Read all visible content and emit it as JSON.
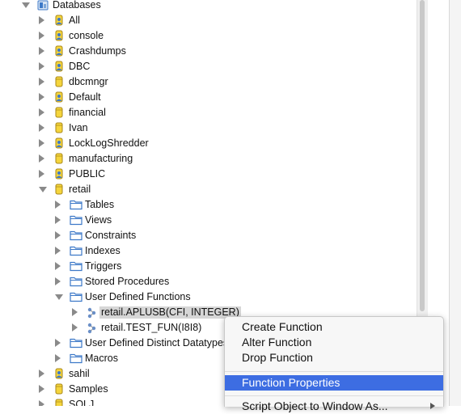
{
  "tree": {
    "root": {
      "label": "Databases",
      "icon": "database-server-icon"
    },
    "databases": [
      {
        "label": "All",
        "icon": "database-user-icon"
      },
      {
        "label": "console",
        "icon": "database-user-icon"
      },
      {
        "label": "Crashdumps",
        "icon": "database-user-icon"
      },
      {
        "label": "DBC",
        "icon": "database-user-icon"
      },
      {
        "label": "dbcmngr",
        "icon": "database-icon"
      },
      {
        "label": "Default",
        "icon": "database-user-icon"
      },
      {
        "label": "financial",
        "icon": "database-icon"
      },
      {
        "label": "Ivan",
        "icon": "database-icon"
      },
      {
        "label": "LockLogShredder",
        "icon": "database-user-icon"
      },
      {
        "label": "manufacturing",
        "icon": "database-icon"
      },
      {
        "label": "PUBLIC",
        "icon": "database-user-icon"
      },
      {
        "label": "retail",
        "icon": "database-icon"
      }
    ],
    "retail_children": [
      {
        "label": "Tables",
        "icon": "folder-icon"
      },
      {
        "label": "Views",
        "icon": "folder-icon"
      },
      {
        "label": "Constraints",
        "icon": "folder-icon"
      },
      {
        "label": "Indexes",
        "icon": "folder-icon"
      },
      {
        "label": "Triggers",
        "icon": "folder-icon"
      },
      {
        "label": "Stored Procedures",
        "icon": "folder-icon"
      },
      {
        "label": "User Defined Functions",
        "icon": "folder-icon"
      }
    ],
    "functions": [
      {
        "label": "retail.APLUSB(CFI, INTEGER)",
        "icon": "function-icon",
        "selected": true
      },
      {
        "label": "retail.TEST_FUN(I8I8)",
        "icon": "function-icon",
        "selected": false
      }
    ],
    "retail_more": [
      {
        "label": "User Defined Distinct Datatypes",
        "icon": "folder-icon"
      },
      {
        "label": "Macros",
        "icon": "folder-icon"
      }
    ],
    "databases_after": [
      {
        "label": "sahil",
        "icon": "database-user-icon"
      },
      {
        "label": "Samples",
        "icon": "database-icon"
      },
      {
        "label": "SQLJ",
        "icon": "database-icon"
      }
    ]
  },
  "context_menu": {
    "items": [
      "Create Function",
      "Alter Function",
      "Drop Function",
      "Function Properties",
      "Script Object to Window As..."
    ],
    "highlighted": "Function Properties"
  },
  "colors": {
    "selection": "#3d6de2",
    "folder": "#3d79c8",
    "database": "#f5d53c",
    "row_selected_bg": "#d6d6d6"
  }
}
